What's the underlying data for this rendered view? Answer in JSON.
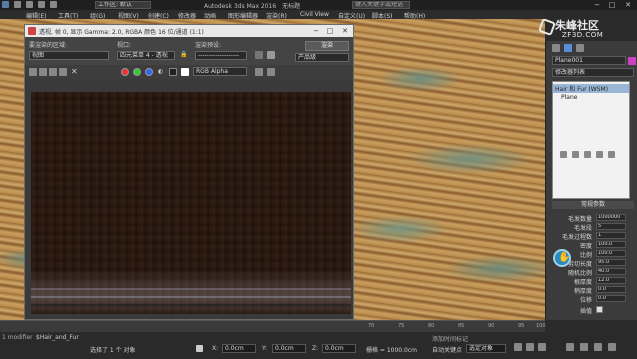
{
  "titlebar": {
    "workspace": "工作区: 默认",
    "app_title": "Autodesk 3ds Max 2016",
    "doc_title": "无标题",
    "search_placeholder": "键入关键字或短语",
    "win_min": "−",
    "win_max": "□",
    "win_close": "✕"
  },
  "menubar": {
    "items": [
      "编辑(E)",
      "工具(T)",
      "组(G)",
      "视图(V)",
      "创建(C)",
      "修改器",
      "动画",
      "图形编辑器",
      "渲染(R)",
      "Civil View",
      "自定义(U)",
      "脚本(S)",
      "帮助(H)"
    ]
  },
  "render_window": {
    "title": "透视, 帧 0, 显示 Gamma: 2.0, RGBA 颜色 16 位/通道 (1:1)",
    "area_label": "要渲染的区域:",
    "area_value": "视图",
    "viewport_label": "视口:",
    "viewport_value": "四元菜单 4 - 透视",
    "preset_label": "渲染预设:",
    "preset_value": "-------------------",
    "render_button": "渲染",
    "production_value": "产品级",
    "channel_value": "RGB Alpha"
  },
  "timeline": {
    "ticks": [
      "70",
      "75",
      "80",
      "85",
      "90",
      "95",
      "100"
    ]
  },
  "status": {
    "script_label": "1 modifier",
    "script_value": "$Hair_and_Fur",
    "selected_text": "选择了 1 个 对象",
    "hint_text": "单击或单击并拖动以选择对象",
    "x_label": "X:",
    "x_value": "0.0cm",
    "y_label": "Y:",
    "y_value": "0.0cm",
    "z_label": "Z:",
    "z_value": "0.0cm",
    "grid_label": "栅格 = 1000.0cm",
    "autokey_label": "自动关键点",
    "selset_value": "选定对象",
    "setkey_label": "设置关键点",
    "keyfilter_label": "关键点过滤器...",
    "add_time_tag": "添加时间标记"
  },
  "command_panel": {
    "object_name": "Plane001",
    "modifier_list": "修改器列表",
    "stack_items": [
      "Hair 和 Fur (WSM)",
      "Plane"
    ],
    "params_header": "常规参数",
    "params": [
      {
        "label": "毛发数量",
        "value": "1000000"
      },
      {
        "label": "毛发段",
        "value": "5"
      },
      {
        "label": "毛发过程数",
        "value": "1"
      },
      {
        "label": "密度",
        "value": "100.0"
      },
      {
        "label": "比例",
        "value": "100.0"
      },
      {
        "label": "剪切长度",
        "value": "95.0"
      },
      {
        "label": "随机比例",
        "value": "40.0"
      },
      {
        "label": "根厚度",
        "value": "12.0"
      },
      {
        "label": "梢厚度",
        "value": "0.0"
      },
      {
        "label": "位移",
        "value": "0.0"
      }
    ],
    "interp_label": "插值"
  },
  "watermark": {
    "cn": "朱峰社区",
    "en": "ZF3D.COM"
  }
}
